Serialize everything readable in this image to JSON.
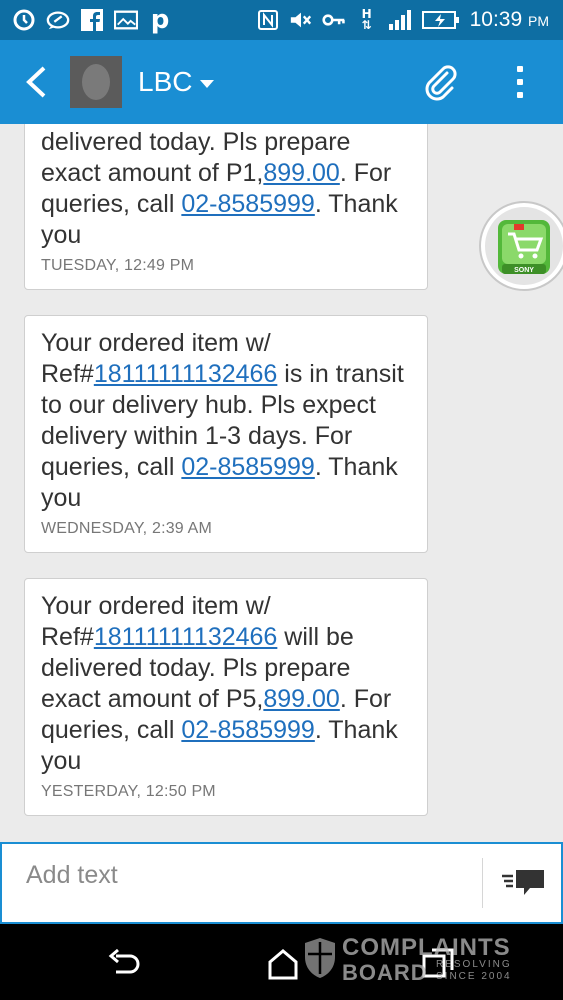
{
  "status_bar": {
    "time": "10:39",
    "ampm": "PM",
    "left_icons": [
      "sync-icon",
      "whatsapp-icon",
      "facebook-icon",
      "photo-icon",
      "paypal-icon"
    ],
    "right_icons": [
      "nfc-icon",
      "mute-icon",
      "vpn-key-icon",
      "hspa-icon",
      "signal-icon",
      "battery-charging-icon"
    ]
  },
  "app_bar": {
    "contact_name": "LBC",
    "icons": [
      "back-arrow-icon",
      "attach-icon",
      "overflow-menu-icon"
    ]
  },
  "messages": [
    {
      "parts": [
        {
          "text": "delivered today. Pls prepare exact amount of P1,"
        },
        {
          "link": "899.00"
        },
        {
          "text": ". For queries, call "
        },
        {
          "link": "02-8585999"
        },
        {
          "text": ". Thank you"
        }
      ],
      "time": "TUESDAY, 12:49 PM"
    },
    {
      "parts": [
        {
          "text": "Your ordered item w/ Ref#"
        },
        {
          "link": "18111111132466"
        },
        {
          "text": " is in transit to our delivery hub. Pls expect delivery within 1-3 days. For queries, call "
        },
        {
          "link": "02-8585999"
        },
        {
          "text": ". Thank you"
        }
      ],
      "time": "WEDNESDAY, 2:39 AM"
    },
    {
      "parts": [
        {
          "text": "Your ordered item w/ Ref#"
        },
        {
          "link": "18111111132466"
        },
        {
          "text": " will be delivered today. Pls prepare exact amount of P5,"
        },
        {
          "link": "899.00"
        },
        {
          "text": ". For queries, call "
        },
        {
          "link": "02-8585999"
        },
        {
          "text": ". Thank you"
        }
      ],
      "time": "YESTERDAY, 12:50 PM"
    }
  ],
  "chat_head": {
    "label": "SONY"
  },
  "composer": {
    "placeholder": "Add text"
  },
  "watermark": {
    "title": "COMPLAINTS",
    "board": "BOARD",
    "resolving": "RESOLVING",
    "since": "SINCE 2004"
  },
  "colors": {
    "status_bar": "#0e6ea3",
    "app_bar": "#1a8ed3",
    "link": "#1f6fbd",
    "background": "#ebebeb"
  }
}
